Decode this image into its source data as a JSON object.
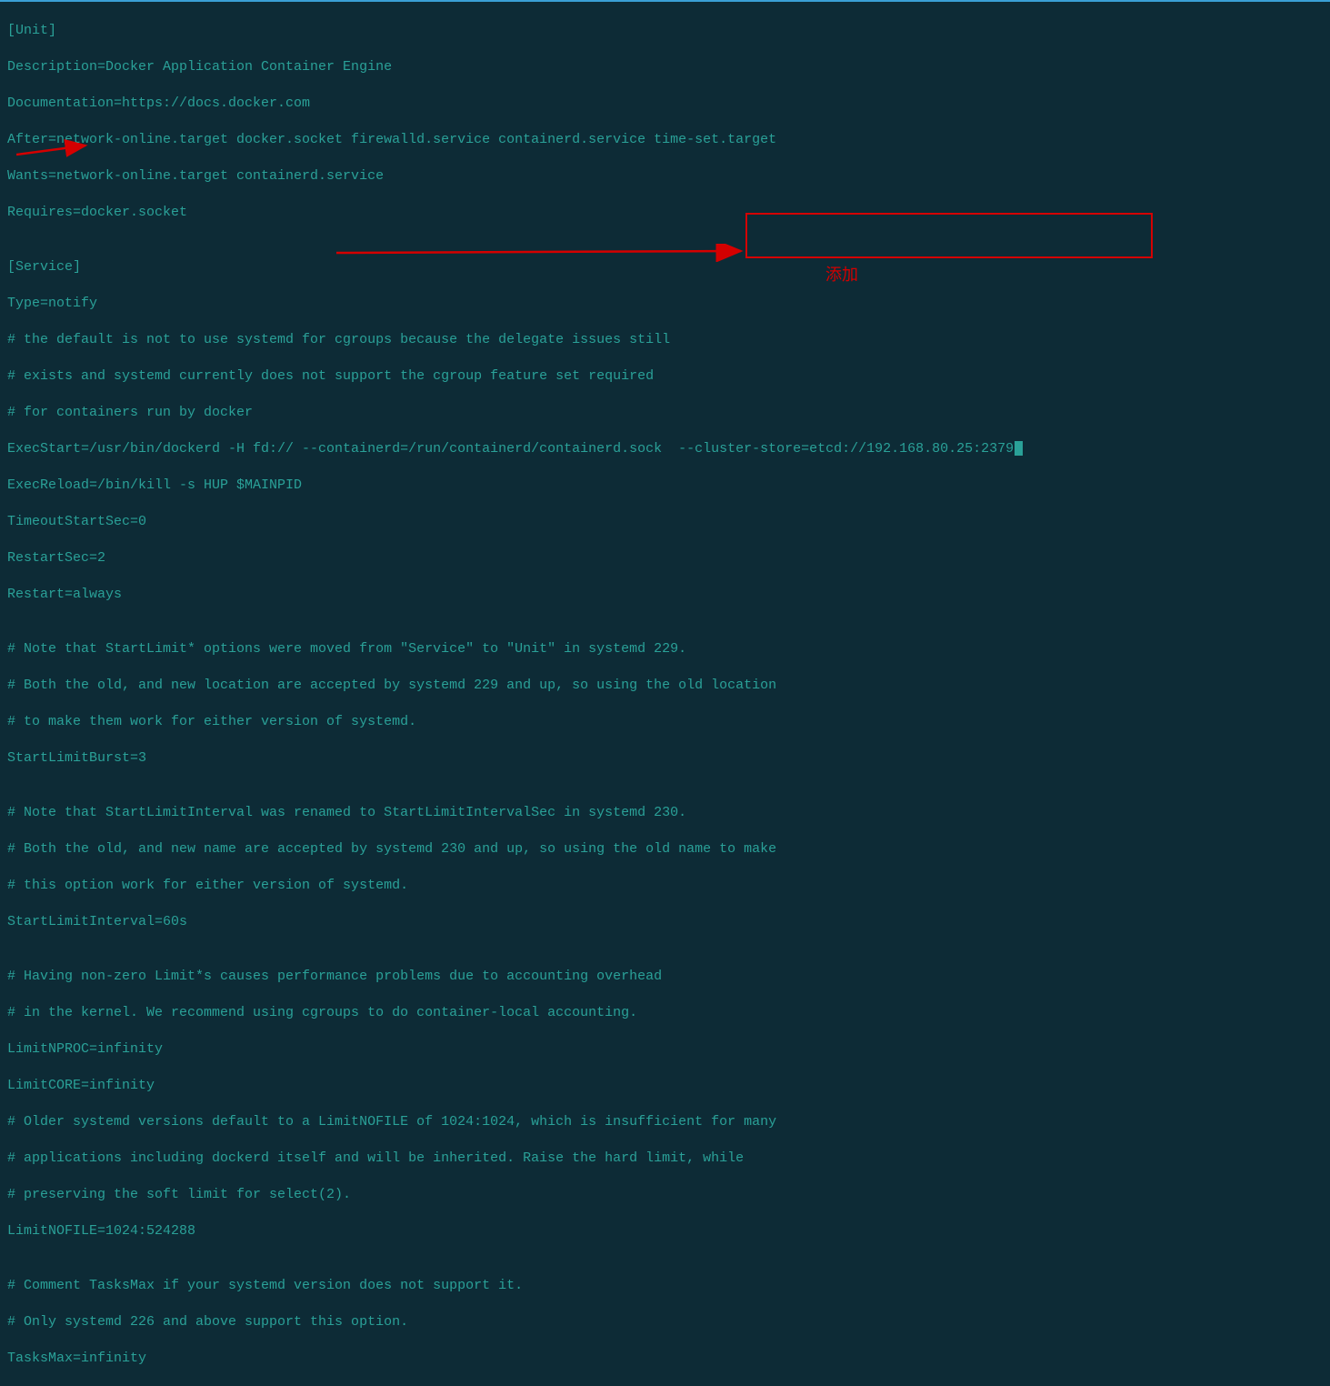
{
  "lines": {
    "l1": "[Unit]",
    "l2": "Description=Docker Application Container Engine",
    "l3": "Documentation=https://docs.docker.com",
    "l4": "After=network-online.target docker.socket firewalld.service containerd.service time-set.target",
    "l5": "Wants=network-online.target containerd.service",
    "l6": "Requires=docker.socket",
    "l7": "",
    "l8": "[Service]",
    "l9": "Type=notify",
    "l10": "# the default is not to use systemd for cgroups because the delegate issues still",
    "l11": "# exists and systemd currently does not support the cgroup feature set required",
    "l12": "# for containers run by docker",
    "l13a": "ExecStart=/usr/bin/dockerd -H fd:// --containerd=/run/containerd/containerd.sock  ",
    "l13b": "--cluster-store=etcd://192.168.80.25:2379",
    "l14": "ExecReload=/bin/kill -s HUP $MAINPID",
    "l15": "TimeoutStartSec=0",
    "l16": "RestartSec=2",
    "l17": "Restart=always",
    "l18": "",
    "l19": "# Note that StartLimit* options were moved from \"Service\" to \"Unit\" in systemd 229.",
    "l20": "# Both the old, and new location are accepted by systemd 229 and up, so using the old location",
    "l21": "# to make them work for either version of systemd.",
    "l22": "StartLimitBurst=3",
    "l23": "",
    "l24": "# Note that StartLimitInterval was renamed to StartLimitIntervalSec in systemd 230.",
    "l25": "# Both the old, and new name are accepted by systemd 230 and up, so using the old name to make",
    "l26": "# this option work for either version of systemd.",
    "l27": "StartLimitInterval=60s",
    "l28": "",
    "l29": "# Having non-zero Limit*s causes performance problems due to accounting overhead",
    "l30": "# in the kernel. We recommend using cgroups to do container-local accounting.",
    "l31": "LimitNPROC=infinity",
    "l32": "LimitCORE=infinity",
    "l33": "# Older systemd versions default to a LimitNOFILE of 1024:1024, which is insufficient for many",
    "l34": "# applications including dockerd itself and will be inherited. Raise the hard limit, while",
    "l35": "# preserving the soft limit for select(2).",
    "l36": "LimitNOFILE=1024:524288",
    "l37": "",
    "l38": "# Comment TasksMax if your systemd version does not support it.",
    "l39": "# Only systemd 226 and above support this option.",
    "l40": "TasksMax=infinity"
  },
  "annotation": {
    "label": "添加"
  }
}
